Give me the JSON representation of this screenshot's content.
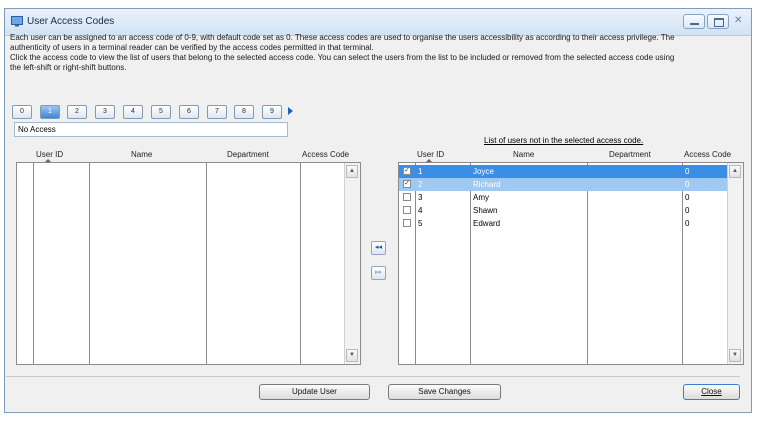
{
  "window": {
    "title": "User Access Codes"
  },
  "description": {
    "line1": "Each user can be assigned to an access code of 0-9, with default code set as 0. These access codes are used to organise the users accessibility as according to their access privilege. The",
    "line2": "authenticity of users in a terminal reader can be verified by the access codes permitted in that terminal.",
    "line3": "Click the access code to view the list of users that belong to the selected access code. You can select the users from the list to be included or removed from the selected access code using",
    "line4": "the left-shift or right-shift buttons."
  },
  "access_codes": [
    "0",
    "1",
    "2",
    "3",
    "4",
    "5",
    "6",
    "7",
    "8",
    "9"
  ],
  "selected_code_index": 1,
  "access_name": "No Access",
  "left_table": {
    "headers": [
      "User ID",
      "Name",
      "Department",
      "Access Code"
    ],
    "rows": []
  },
  "right_table": {
    "caption": "List of users not in the selected access code.",
    "headers": [
      "User ID",
      "Name",
      "Department",
      "Access Code"
    ],
    "rows": [
      {
        "checked": true,
        "id": "1",
        "name": "Joyce",
        "dept": "",
        "code": "0"
      },
      {
        "checked": true,
        "id": "2",
        "name": "Richard",
        "dept": "",
        "code": "0"
      },
      {
        "checked": false,
        "id": "3",
        "name": "Amy",
        "dept": "",
        "code": "0"
      },
      {
        "checked": false,
        "id": "4",
        "name": "Shawn",
        "dept": "",
        "code": "0"
      },
      {
        "checked": false,
        "id": "5",
        "name": "Edward",
        "dept": "",
        "code": "0"
      }
    ]
  },
  "buttons": {
    "shift_left": "◂◂",
    "shift_right": "▸▸",
    "update_user": "Update User",
    "save_changes": "Save Changes",
    "close": "Close"
  },
  "colors": {
    "accent": "#3a8ee6",
    "selected_light": "#9ec9f2"
  }
}
